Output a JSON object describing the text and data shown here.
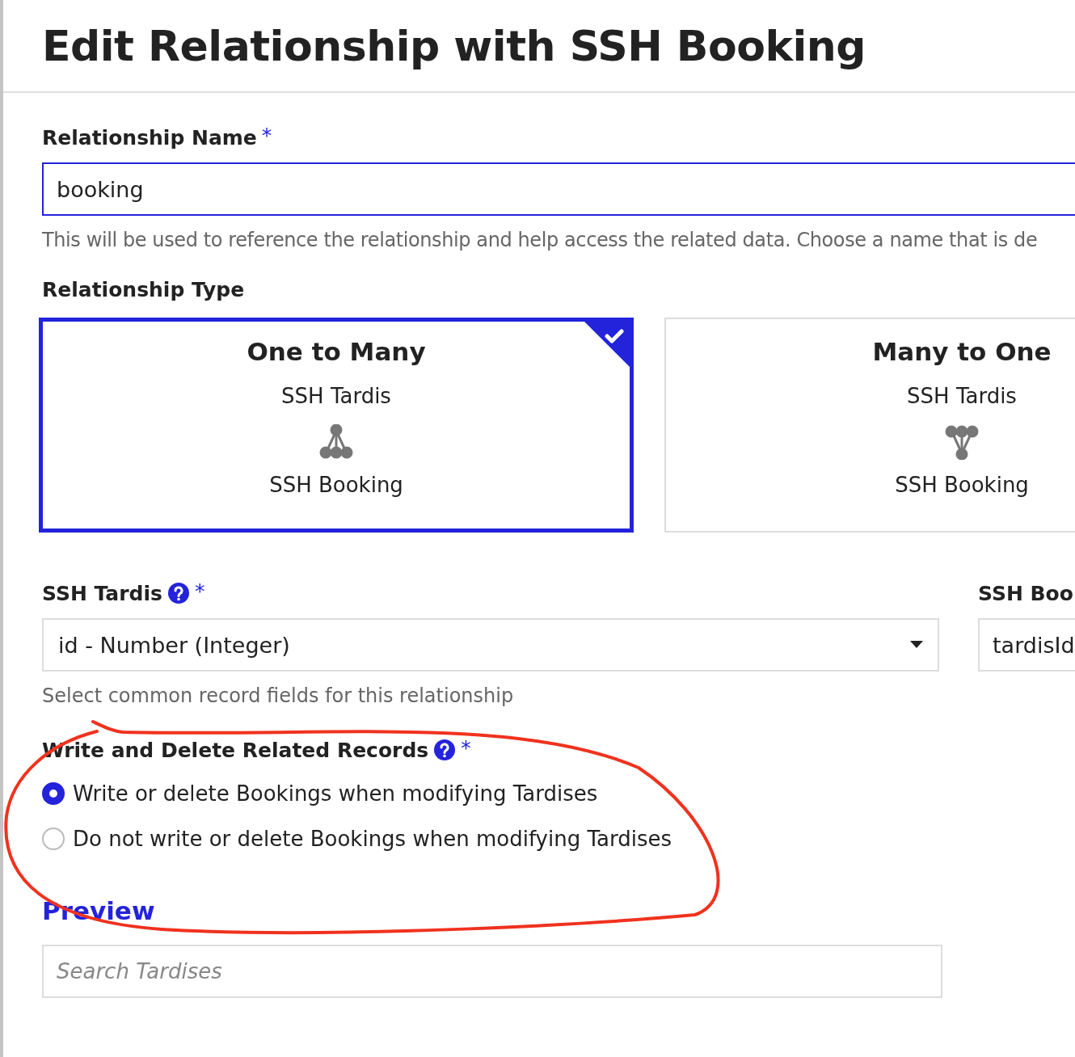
{
  "title": "Edit Relationship with SSH Booking",
  "relationship_name": {
    "label": "Relationship Name",
    "required_mark": "*",
    "value": "booking",
    "help": "This will be used to reference the relationship and help access the related data. Choose a name that is de"
  },
  "relationship_type": {
    "label": "Relationship Type",
    "options": [
      {
        "kind": "one_to_many",
        "title": "One to Many",
        "parent": "SSH Tardis",
        "child": "SSH Booking",
        "selected": true
      },
      {
        "kind": "many_to_one",
        "title": "Many to One",
        "parent": "SSH Tardis",
        "child": "SSH Booking",
        "selected": false
      }
    ]
  },
  "fields": [
    {
      "kind": "select",
      "label": "SSH Tardis",
      "help_icon": true,
      "required_mark": "*",
      "value": "id - Number (Integer)"
    },
    {
      "kind": "text",
      "label": "SSH Boo",
      "help_icon": false,
      "value": "tardisId"
    }
  ],
  "fields_help": "Select common record fields for this relationship",
  "write_delete": {
    "label": "Write and Delete Related Records",
    "help_icon": true,
    "required_mark": "*",
    "options": [
      {
        "label": "Write or delete Bookings when modifying Tardises",
        "selected": true
      },
      {
        "label": "Do not write or delete Bookings when modifying Tardises",
        "selected": false
      }
    ]
  },
  "annotation": true,
  "preview": {
    "title": "Preview",
    "search_placeholder": "Search Tardises"
  }
}
